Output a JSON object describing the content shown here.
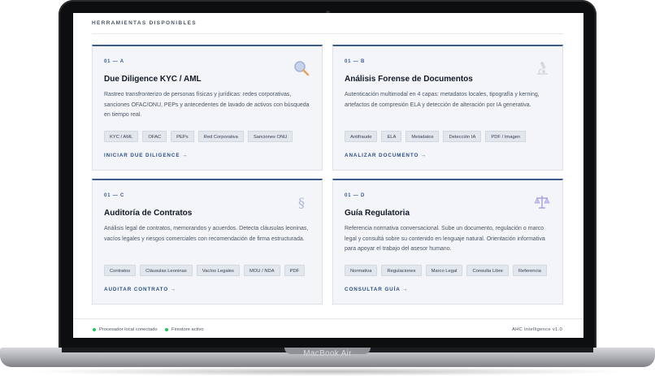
{
  "device": {
    "brand": "MacBook Air"
  },
  "section": {
    "title": "HERRAMIENTAS DISPONIBLES"
  },
  "cards": [
    {
      "code": "01 — A",
      "title": "Due Diligence KYC / AML",
      "description": "Rastreo transfronterizo de personas físicas y jurídicas: redes corporativas, sanciones OFAC/ONU, PEPs y antecedentes de lavado de activos con búsqueda en tiempo real.",
      "tags": [
        "KYC / AML",
        "OFAC",
        "PEPs",
        "Red Corporativa",
        "Sanciones ONU"
      ],
      "action": "INICIAR DUE DILIGENCE →",
      "icon": "magnifier-icon"
    },
    {
      "code": "01 — B",
      "title": "Análisis Forense de Documentos",
      "description": "Autenticación multimodal en 4 capas: metadatos locales, tipografía y kerning, artefactos de compresión ELA y detección de alteración por IA generativa.",
      "tags": [
        "Antifraude",
        "ELA",
        "Metadatos",
        "Detección IA",
        "PDF / Imagen"
      ],
      "action": "ANALIZAR DOCUMENTO →",
      "icon": "microscope-icon"
    },
    {
      "code": "01 — C",
      "title": "Auditoría de Contratos",
      "description": "Análisis legal de contratos, memorandos y acuerdos. Detecta cláusulas leoninas, vacíos legales y riesgos comerciales con recomendación de firma estructurada.",
      "tags": [
        "Contratos",
        "Cláusulas Leoninas",
        "Vacíos Legales",
        "MOU / NDA",
        "PDF"
      ],
      "action": "AUDITAR CONTRATO →",
      "icon": "section-sign-icon"
    },
    {
      "code": "01 — D",
      "title": "Guía Regulatoria",
      "description": "Referencia normativa conversacional. Sube un documento, regulación o marco legal y consultá sobre su contenido en lenguaje natural. Orientación informativa para apoyar el trabajo del asesor humano.",
      "tags": [
        "Normativa",
        "Regulaciones",
        "Marco Legal",
        "Consulta Libre",
        "Referencia"
      ],
      "action": "CONSULTAR GUÍA →",
      "icon": "scales-icon"
    }
  ],
  "footer": {
    "status_local": "Procesador local conectado",
    "status_firestore": "Firestore activo",
    "version": "AHC Intelligence v1.0"
  },
  "colors": {
    "accent": "#3c5a8a",
    "status_ok": "#22c55e"
  }
}
